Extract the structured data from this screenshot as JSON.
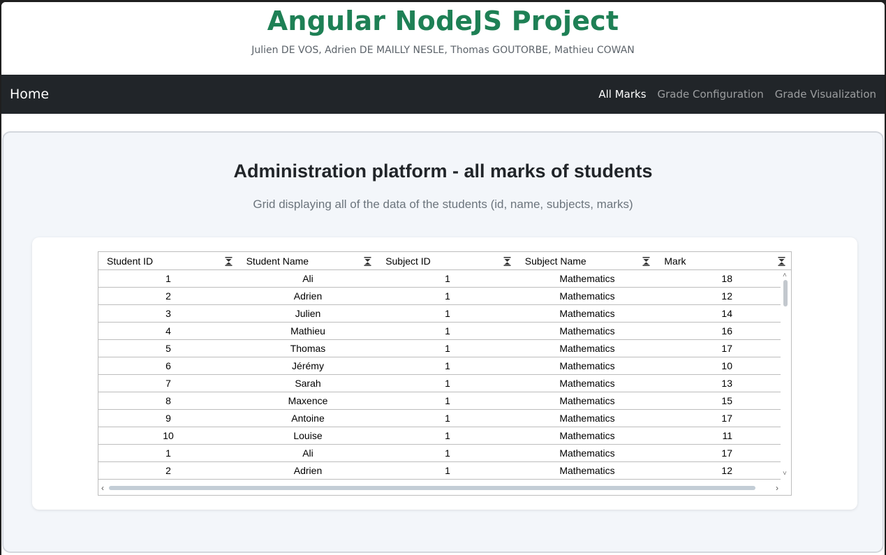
{
  "header": {
    "title": "Angular NodeJS Project",
    "authors": "Julien DE VOS, Adrien DE MAILLY NESLE, Thomas GOUTORBE, Mathieu COWAN"
  },
  "navbar": {
    "brand": "Home",
    "links": [
      "All Marks",
      "Grade Configuration",
      "Grade Visualization"
    ],
    "active": "All Marks"
  },
  "main": {
    "heading": "Administration platform - all marks of students",
    "subtitle": "Grid displaying all of the data of the students (id, name, subjects, marks)"
  },
  "grid": {
    "columns": [
      "Student ID",
      "Student Name",
      "Subject ID",
      "Subject Name",
      "Mark"
    ],
    "rows": [
      [
        "1",
        "Ali",
        "1",
        "Mathematics",
        "18"
      ],
      [
        "2",
        "Adrien",
        "1",
        "Mathematics",
        "12"
      ],
      [
        "3",
        "Julien",
        "1",
        "Mathematics",
        "14"
      ],
      [
        "4",
        "Mathieu",
        "1",
        "Mathematics",
        "16"
      ],
      [
        "5",
        "Thomas",
        "1",
        "Mathematics",
        "17"
      ],
      [
        "6",
        "Jérémy",
        "1",
        "Mathematics",
        "10"
      ],
      [
        "7",
        "Sarah",
        "1",
        "Mathematics",
        "13"
      ],
      [
        "8",
        "Maxence",
        "1",
        "Mathematics",
        "15"
      ],
      [
        "9",
        "Antoine",
        "1",
        "Mathematics",
        "17"
      ],
      [
        "10",
        "Louise",
        "1",
        "Mathematics",
        "11"
      ],
      [
        "1",
        "Ali",
        "1",
        "Mathematics",
        "17"
      ],
      [
        "2",
        "Adrien",
        "1",
        "Mathematics",
        "12"
      ]
    ]
  },
  "colors": {
    "title_green": "#1e8055",
    "navbar_bg": "#212529",
    "panel_bg": "#f3f6fa"
  }
}
